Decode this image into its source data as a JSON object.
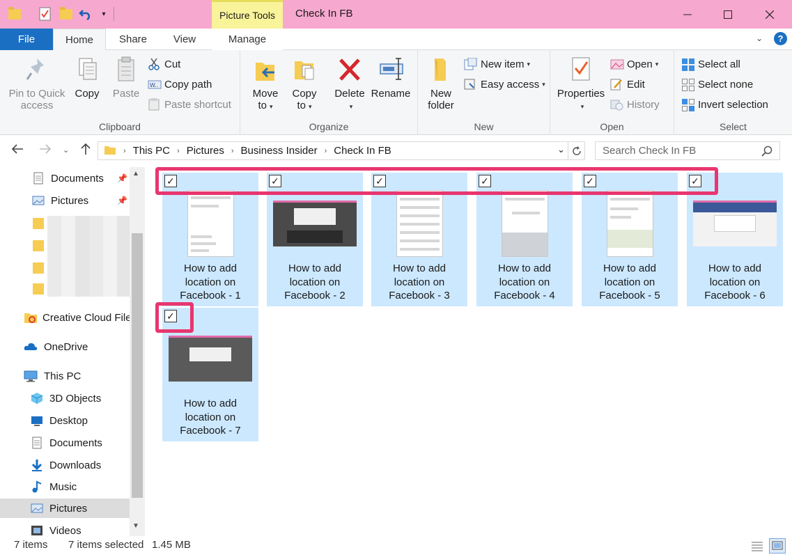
{
  "window": {
    "title": "Check In FB",
    "context_tab": "Picture Tools"
  },
  "tabs": {
    "file": "File",
    "home": "Home",
    "share": "Share",
    "view": "View",
    "manage": "Manage"
  },
  "ribbon": {
    "clipboard": {
      "label": "Clipboard",
      "pin": "Pin to Quick access",
      "copy": "Copy",
      "paste": "Paste",
      "cut": "Cut",
      "copy_path": "Copy path",
      "paste_shortcut": "Paste shortcut"
    },
    "organize": {
      "label": "Organize",
      "move_to": "Move to",
      "copy_to": "Copy to",
      "delete": "Delete",
      "rename": "Rename"
    },
    "new": {
      "label": "New",
      "new_folder": "New folder",
      "new_item": "New item",
      "easy_access": "Easy access"
    },
    "open": {
      "label": "Open",
      "properties": "Properties",
      "open": "Open",
      "edit": "Edit",
      "history": "History"
    },
    "select": {
      "label": "Select",
      "select_all": "Select all",
      "select_none": "Select none",
      "invert": "Invert selection"
    }
  },
  "address": {
    "crumbs": [
      "This PC",
      "Pictures",
      "Business Insider",
      "Check In FB"
    ],
    "search_placeholder": "Search Check In FB"
  },
  "nav": {
    "documents_pinned": "Documents",
    "pictures_pinned": "Pictures",
    "creative_cloud": "Creative Cloud Files",
    "onedrive": "OneDrive",
    "this_pc": "This PC",
    "objects_3d": "3D Objects",
    "desktop": "Desktop",
    "documents": "Documents",
    "downloads": "Downloads",
    "music": "Music",
    "pictures": "Pictures",
    "videos": "Videos"
  },
  "files": [
    {
      "name": "How to add location on Facebook - 1",
      "line1": "How to add",
      "line2": "location on",
      "line3": "Facebook - 1",
      "thumb": "phone"
    },
    {
      "name": "How to add location on Facebook - 2",
      "line1": "How to add",
      "line2": "location on",
      "line3": "Facebook - 2",
      "thumb": "screen"
    },
    {
      "name": "How to add location on Facebook - 3",
      "line1": "How to add",
      "line2": "location on",
      "line3": "Facebook - 3",
      "thumb": "phone"
    },
    {
      "name": "How to add location on Facebook - 4",
      "line1": "How to add",
      "line2": "location on",
      "line3": "Facebook - 4",
      "thumb": "phone"
    },
    {
      "name": "How to add location on Facebook - 5",
      "line1": "How to add",
      "line2": "location on",
      "line3": "Facebook - 5",
      "thumb": "phone"
    },
    {
      "name": "How to add location on Facebook - 6",
      "line1": "How to add",
      "line2": "location on",
      "line3": "Facebook - 6",
      "thumb": "screen"
    },
    {
      "name": "How to add location on Facebook - 7",
      "line1": "How to add",
      "line2": "location on",
      "line3": "Facebook - 7",
      "thumb": "screen"
    }
  ],
  "status": {
    "items": "7 items",
    "selected": "7 items selected",
    "size": "1.45 MB"
  },
  "colors": {
    "titlebar": "#f7a8cf",
    "context_tab": "#f9f49a",
    "file_tab": "#1a6fc3",
    "selection": "#cce8ff",
    "highlight": "#e8366f"
  }
}
